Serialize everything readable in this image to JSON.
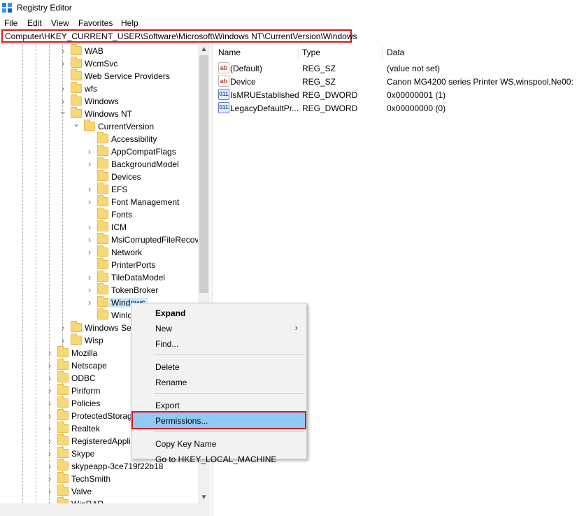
{
  "window": {
    "title": "Registry Editor"
  },
  "menu": [
    "File",
    "Edit",
    "View",
    "Favorites",
    "Help"
  ],
  "address": "Computer\\HKEY_CURRENT_USER\\Software\\Microsoft\\Windows NT\\CurrentVersion\\Windows",
  "tree": [
    {
      "label": "WAB",
      "level": 2,
      "expander": true
    },
    {
      "label": "WcmSvc",
      "level": 2,
      "expander": true
    },
    {
      "label": "Web Service Providers",
      "level": 2,
      "expander": false
    },
    {
      "label": "wfs",
      "level": 2,
      "expander": true
    },
    {
      "label": "Windows",
      "level": 2,
      "expander": true
    },
    {
      "label": "Windows NT",
      "level": 2,
      "expander": "open"
    },
    {
      "label": "CurrentVersion",
      "level": 3,
      "expander": "open"
    },
    {
      "label": "Accessibility",
      "level": 4,
      "expander": false
    },
    {
      "label": "AppCompatFlags",
      "level": 4,
      "expander": true
    },
    {
      "label": "BackgroundModel",
      "level": 4,
      "expander": true
    },
    {
      "label": "Devices",
      "level": 4,
      "expander": false
    },
    {
      "label": "EFS",
      "level": 4,
      "expander": true
    },
    {
      "label": "Font Management",
      "level": 4,
      "expander": true
    },
    {
      "label": "Fonts",
      "level": 4,
      "expander": false
    },
    {
      "label": "ICM",
      "level": 4,
      "expander": true
    },
    {
      "label": "MsiCorruptedFileRecov",
      "level": 4,
      "expander": true
    },
    {
      "label": "Network",
      "level": 4,
      "expander": true
    },
    {
      "label": "PrinterPorts",
      "level": 4,
      "expander": false
    },
    {
      "label": "TileDataModel",
      "level": 4,
      "expander": true
    },
    {
      "label": "TokenBroker",
      "level": 4,
      "expander": true
    },
    {
      "label": "Windows",
      "level": 4,
      "expander": true,
      "selected": true
    },
    {
      "label": "Winlo",
      "level": 4,
      "expander": false
    },
    {
      "label": "Windows Se",
      "level": 2,
      "expander": true
    },
    {
      "label": "Wisp",
      "level": 2,
      "expander": true
    },
    {
      "label": "Mozilla",
      "level": 1,
      "expander": true
    },
    {
      "label": "Netscape",
      "level": 1,
      "expander": true
    },
    {
      "label": "ODBC",
      "level": 1,
      "expander": true
    },
    {
      "label": "Piriform",
      "level": 1,
      "expander": true
    },
    {
      "label": "Policies",
      "level": 1,
      "expander": true
    },
    {
      "label": "ProtectedStorag",
      "level": 1,
      "expander": true
    },
    {
      "label": "Realtek",
      "level": 1,
      "expander": true
    },
    {
      "label": "RegisteredAppli",
      "level": 1,
      "expander": true
    },
    {
      "label": "Skype",
      "level": 1,
      "expander": true
    },
    {
      "label": "skypeapp-3ce719f22b18",
      "level": 1,
      "expander": true
    },
    {
      "label": "TechSmith",
      "level": 1,
      "expander": true
    },
    {
      "label": "Valve",
      "level": 1,
      "expander": true
    },
    {
      "label": "WinRAR",
      "level": 1,
      "expander": true
    }
  ],
  "list": {
    "columns": [
      "Name",
      "Type",
      "Data"
    ],
    "rows": [
      {
        "icon": "string-value-icon",
        "glyph": "ab",
        "kind": "sz",
        "name": "(Default)",
        "type": "REG_SZ",
        "data": "(value not set)"
      },
      {
        "icon": "string-value-icon",
        "glyph": "ab",
        "kind": "sz",
        "name": "Device",
        "type": "REG_SZ",
        "data": "Canon MG4200 series Printer WS,winspool,Ne00:"
      },
      {
        "icon": "dword-value-icon",
        "glyph": "011",
        "kind": "dw",
        "name": "IsMRUEstablished",
        "type": "REG_DWORD",
        "data": "0x00000001 (1)"
      },
      {
        "icon": "dword-value-icon",
        "glyph": "011",
        "kind": "dw",
        "name": "LegacyDefaultPr...",
        "type": "REG_DWORD",
        "data": "0x00000000 (0)"
      }
    ]
  },
  "context_menu": {
    "items": [
      {
        "label": "Expand",
        "bold": true
      },
      {
        "label": "New",
        "submenu": true
      },
      {
        "label": "Find..."
      },
      {
        "separator": true
      },
      {
        "label": "Delete"
      },
      {
        "label": "Rename"
      },
      {
        "separator": true
      },
      {
        "label": "Export"
      },
      {
        "label": "Permissions...",
        "highlight": true
      },
      {
        "separator": true
      },
      {
        "label": "Copy Key Name"
      },
      {
        "label": "Go to HKEY_LOCAL_MACHINE"
      }
    ]
  },
  "colors": {
    "highlight_outline": "#e3141a",
    "menu_hover": "#91c9f7",
    "folder": "#f8d775",
    "selection": "#cce8ff"
  }
}
